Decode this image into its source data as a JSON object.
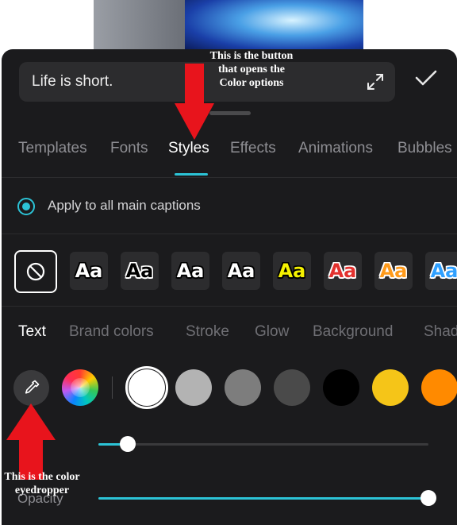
{
  "caption_input": {
    "value": "Life is short."
  },
  "tabs": [
    {
      "label": "Templates"
    },
    {
      "label": "Fonts"
    },
    {
      "label": "Styles"
    },
    {
      "label": "Effects"
    },
    {
      "label": "Animations"
    },
    {
      "label": "Bubbles"
    }
  ],
  "apply_option": {
    "label": "Apply to all main captions"
  },
  "style_presets": [
    {
      "label": "Aa",
      "fill": "#ffffff",
      "stroke": "#000000"
    },
    {
      "label": "Aa",
      "fill": "#000000",
      "stroke": "#ffffff"
    },
    {
      "label": "Aa",
      "fill": "#ffffff",
      "stroke": "#000000"
    },
    {
      "label": "Aa",
      "fill": "#ffffff",
      "stroke": "#000000"
    },
    {
      "label": "Aa",
      "fill": "#f5f200",
      "stroke": "#000000"
    },
    {
      "label": "Aa",
      "fill": "#e3312e",
      "stroke": "#ffffff"
    },
    {
      "label": "Aa",
      "fill": "#ff9a1a",
      "stroke": "#ffffff"
    },
    {
      "label": "Aa",
      "fill": "#2fa0ff",
      "stroke": "#ffffff"
    }
  ],
  "subtabs": [
    {
      "label": "Text"
    },
    {
      "label": "Brand colors"
    },
    {
      "label": "Stroke"
    },
    {
      "label": "Glow"
    },
    {
      "label": "Background"
    },
    {
      "label": "Shad"
    }
  ],
  "swatches": [
    "#ffffff",
    "#b3b3b3",
    "#7d7d7d",
    "#4a4a4a",
    "#000000",
    "#f5c518",
    "#ff8a00"
  ],
  "sliders": {
    "first_level": 0.09,
    "opacity_label": "Opacity",
    "opacity_level": 1.0
  },
  "annotations": {
    "styles_note": "This is the button that opens the Color options",
    "eyedropper_note": "This is the color eyedropper"
  },
  "colors": {
    "accent": "#2cc3d6",
    "panel": "#1b1b1d",
    "arrow": "#e8141c"
  }
}
